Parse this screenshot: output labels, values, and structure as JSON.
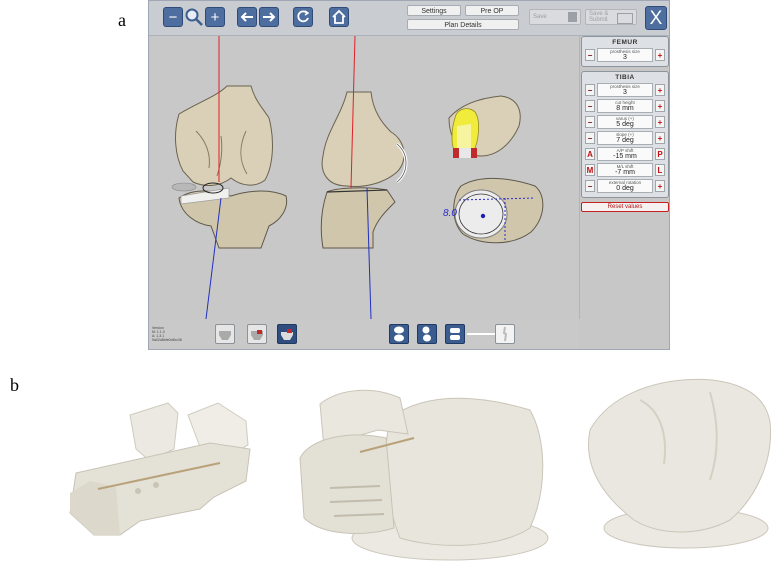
{
  "labels": {
    "a": "a",
    "b": "b"
  },
  "toolbar": {
    "zoom_out": "−",
    "zoom_in": "+",
    "settings": "Settings",
    "pre_op": "Pre OP",
    "plan_details": "Plan Details",
    "save": "Save",
    "save_submit": "Save & Submit",
    "close": "X"
  },
  "femur": {
    "title": "FEMUR",
    "controls": [
      {
        "caption": "prosthesis size",
        "value": "3",
        "left": "−",
        "right": "+"
      }
    ]
  },
  "tibia": {
    "title": "TIBIA",
    "controls": [
      {
        "caption": "prosthesis size",
        "value": "3",
        "left": "−",
        "right": "+"
      },
      {
        "caption": "cut height",
        "value": "8   mm",
        "left": "−",
        "right": "+"
      },
      {
        "caption": "varus (+)",
        "value": "5   deg",
        "left": "−",
        "right": "+"
      },
      {
        "caption": "slope (+)",
        "value": "7   deg",
        "left": "−",
        "right": "+"
      },
      {
        "caption": "A/P shift",
        "value": "-15   mm",
        "left": "A",
        "right": "P"
      },
      {
        "caption": "M/L shift",
        "value": "-7   mm",
        "left": "M",
        "right": "L"
      },
      {
        "caption": "external rotation",
        "value": "0   deg",
        "left": "−",
        "right": "+"
      }
    ],
    "reset": "Reset values"
  },
  "viewport": {
    "measure": "8.0"
  },
  "version_text": [
    "Version",
    "M: 1.1.0",
    "A: 1.3.1",
    "9a02d6bfe0c6bc36"
  ],
  "colors": {
    "accent": "#4d6e9e",
    "laser_red": "#e0202a",
    "laser_blue": "#2030c0",
    "bone": "#d8cfb6",
    "reset": "#c42020"
  }
}
